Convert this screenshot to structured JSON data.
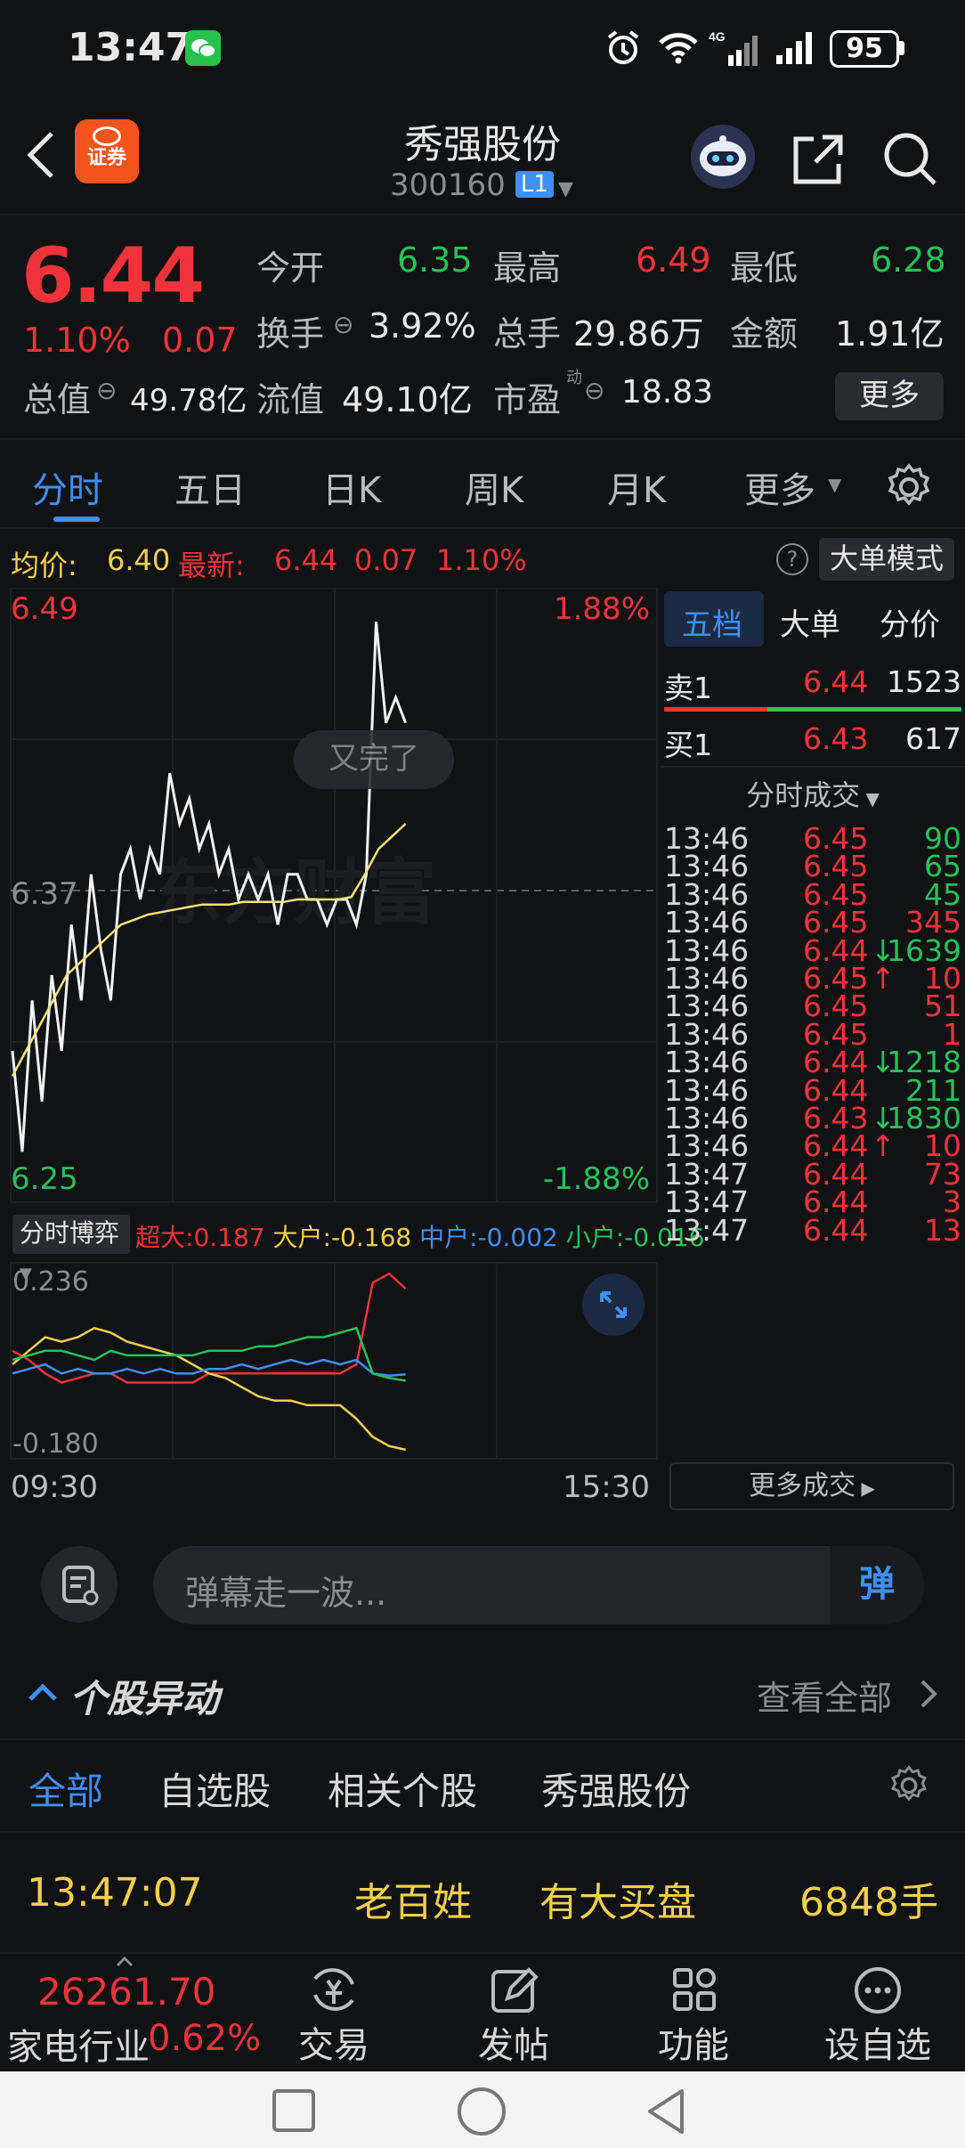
{
  "status_bar": {
    "time": "13:47",
    "battery": "95"
  },
  "header": {
    "title": "秀强股份",
    "code": "300160",
    "level_badge": "L1",
    "broker_badge": "证券"
  },
  "quote": {
    "price": "6.44",
    "change_pct": "1.10%",
    "change": "0.07",
    "open_label": "今开",
    "open": "6.35",
    "high_label": "最高",
    "high": "6.49",
    "low_label": "最低",
    "low": "6.28",
    "turnover_label": "换手",
    "turnover": "3.92%",
    "volume_label": "总手",
    "volume": "29.86万",
    "amount_label": "金额",
    "amount": "1.91亿",
    "mktcap_label": "总值",
    "mktcap": "49.78亿",
    "float_label": "流值",
    "float_value": "49.10亿",
    "pe_label": "市盈",
    "pe_sup": "动",
    "pe": "18.83",
    "more_label": "更多"
  },
  "tabs": [
    "分时",
    "五日",
    "日K",
    "周K",
    "月K",
    "更多"
  ],
  "avg_bar": {
    "avg_label": "均价:",
    "avg": "6.40",
    "latest_label": "最新:",
    "latest": "6.44",
    "change": "0.07",
    "pct": "1.10%",
    "mode_label": "大单模式"
  },
  "chart": {
    "top_price": "6.49",
    "top_pct": "1.88%",
    "mid_price": "6.37",
    "bottom_price": "6.25",
    "bottom_pct": "-1.88%",
    "bubble": "又完了",
    "start_time": "09:30",
    "end_time": "15:30",
    "indicator_label": "分时博弈",
    "flow": [
      {
        "label": "超大:",
        "value": "0.187",
        "color": "#f0333a"
      },
      {
        "label": "大户:",
        "value": "-0.168",
        "color": "#f3cf4c"
      },
      {
        "label": "中户:",
        "value": "-0.002",
        "color": "#3f8ff5"
      },
      {
        "label": "小户:",
        "value": "-0.016",
        "color": "#24c25a"
      }
    ],
    "flow_top": "0.236",
    "flow_bottom": "-0.180"
  },
  "chart_data": [
    {
      "type": "line",
      "ylim": [
        6.25,
        6.49
      ],
      "series": [
        {
          "values": [
            6.31,
            6.27,
            6.33,
            6.29,
            6.34,
            6.31,
            6.36,
            6.33,
            6.38,
            6.35,
            6.33,
            6.38,
            6.39,
            6.37,
            6.39,
            6.38,
            6.42,
            6.4,
            6.41,
            6.39,
            6.4,
            6.38,
            6.39,
            6.37,
            6.38,
            6.37,
            6.38,
            6.36,
            6.38,
            6.38,
            6.37,
            6.37,
            6.36,
            6.37,
            6.37,
            6.36,
            6.38,
            6.48,
            6.44,
            6.45,
            6.44
          ]
        },
        {
          "values": [
            6.3,
            6.31,
            6.32,
            6.33,
            6.34,
            6.345,
            6.35,
            6.355,
            6.36,
            6.362,
            6.364,
            6.365,
            6.366,
            6.367,
            6.368,
            6.368,
            6.368,
            6.369,
            6.369,
            6.369,
            6.369,
            6.37,
            6.37,
            6.37,
            6.37,
            6.371,
            6.38,
            6.39,
            6.395,
            6.4
          ]
        }
      ]
    },
    {
      "type": "line",
      "ylim": [
        -0.18,
        0.236
      ],
      "series": [
        {
          "values": [
            0.05,
            0.03,
            0.0,
            -0.02,
            -0.01,
            0.0,
            0.0,
            -0.02,
            -0.02,
            -0.02,
            -0.02,
            -0.02,
            0.0,
            0.0,
            0.0,
            0.0,
            0.0,
            0.0,
            0.0,
            0.0,
            0.0,
            0.02,
            0.2,
            0.22,
            0.187
          ]
        },
        {
          "values": [
            0.02,
            0.05,
            0.08,
            0.07,
            0.08,
            0.1,
            0.09,
            0.07,
            0.06,
            0.05,
            0.04,
            0.02,
            0.0,
            -0.01,
            -0.03,
            -0.05,
            -0.06,
            -0.06,
            -0.07,
            -0.07,
            -0.07,
            -0.1,
            -0.14,
            -0.16,
            -0.168
          ]
        },
        {
          "values": [
            0.0,
            0.01,
            0.02,
            0.0,
            0.01,
            0.0,
            0.0,
            0.01,
            0.0,
            0.01,
            0.0,
            0.0,
            0.01,
            0.01,
            0.02,
            0.01,
            0.02,
            0.03,
            0.02,
            0.03,
            0.02,
            0.03,
            0.0,
            -0.005,
            -0.002
          ]
        },
        {
          "values": [
            0.03,
            0.04,
            0.05,
            0.05,
            0.04,
            0.03,
            0.05,
            0.04,
            0.04,
            0.04,
            0.04,
            0.04,
            0.05,
            0.05,
            0.05,
            0.06,
            0.06,
            0.07,
            0.08,
            0.08,
            0.09,
            0.1,
            0.0,
            -0.01,
            -0.016
          ]
        }
      ]
    }
  ],
  "side": {
    "tabs": [
      "五档",
      "大单",
      "分价"
    ],
    "sell1_label": "卖1",
    "sell1_price": "6.44",
    "sell1_vol": "1523",
    "buy1_label": "买1",
    "buy1_price": "6.43",
    "buy1_vol": "617",
    "ticks_title": "分时成交",
    "ticks": [
      {
        "time": "13:46",
        "price": "6.45",
        "arrow": "",
        "vol": "90",
        "pc": "red",
        "vc": "green"
      },
      {
        "time": "13:46",
        "price": "6.45",
        "arrow": "",
        "vol": "65",
        "pc": "red",
        "vc": "green"
      },
      {
        "time": "13:46",
        "price": "6.45",
        "arrow": "",
        "vol": "45",
        "pc": "red",
        "vc": "green"
      },
      {
        "time": "13:46",
        "price": "6.45",
        "arrow": "",
        "vol": "345",
        "pc": "red",
        "vc": "red"
      },
      {
        "time": "13:46",
        "price": "6.44",
        "arrow": "↓",
        "vol": "1639",
        "pc": "red",
        "vc": "green"
      },
      {
        "time": "13:46",
        "price": "6.45",
        "arrow": "↑",
        "vol": "10",
        "pc": "red",
        "vc": "red"
      },
      {
        "time": "13:46",
        "price": "6.45",
        "arrow": "",
        "vol": "51",
        "pc": "red",
        "vc": "red"
      },
      {
        "time": "13:46",
        "price": "6.45",
        "arrow": "",
        "vol": "1",
        "pc": "red",
        "vc": "red"
      },
      {
        "time": "13:46",
        "price": "6.44",
        "arrow": "↓",
        "vol": "1218",
        "pc": "red",
        "vc": "green"
      },
      {
        "time": "13:46",
        "price": "6.44",
        "arrow": "",
        "vol": "211",
        "pc": "red",
        "vc": "green"
      },
      {
        "time": "13:46",
        "price": "6.43",
        "arrow": "↓",
        "vol": "1830",
        "pc": "red",
        "vc": "green"
      },
      {
        "time": "13:46",
        "price": "6.44",
        "arrow": "↑",
        "vol": "10",
        "pc": "red",
        "vc": "red"
      },
      {
        "time": "13:47",
        "price": "6.44",
        "arrow": "",
        "vol": "73",
        "pc": "red",
        "vc": "red"
      },
      {
        "time": "13:47",
        "price": "6.44",
        "arrow": "",
        "vol": "3",
        "pc": "red",
        "vc": "red"
      },
      {
        "time": "13:47",
        "price": "6.44",
        "arrow": "",
        "vol": "13",
        "pc": "red",
        "vc": "red"
      }
    ],
    "more_ticks": "更多成交"
  },
  "danmu": {
    "placeholder": "弹幕走一波...",
    "send_label": "弹"
  },
  "movement": {
    "title": "个股异动",
    "view_all": "查看全部",
    "filters": [
      "全部",
      "自选股",
      "相关个股",
      "秀强股份"
    ],
    "items": [
      {
        "time": "13:47:07",
        "who": "老百姓",
        "what": "有大买盘",
        "qty": "6848手"
      }
    ]
  },
  "bottom": {
    "index_value": "26261.70",
    "index_name": "家电行业",
    "index_pct": "0.62%",
    "nav": [
      "交易",
      "发帖",
      "功能",
      "设自选"
    ]
  },
  "colors": {
    "up": "#f0333a",
    "down": "#24c25a",
    "accent": "#3f8ff5",
    "warn": "#f3cf4c",
    "bg": "#111214"
  }
}
